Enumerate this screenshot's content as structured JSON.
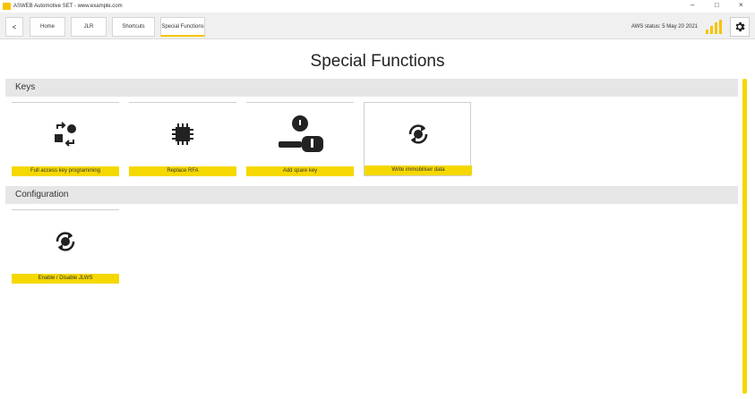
{
  "window": {
    "title": "ASWEB Automotive SET - www.example.com",
    "controls": {
      "minimize": "–",
      "maximize": "□",
      "close": "×"
    }
  },
  "toolbar": {
    "back_arrow": "<",
    "back_small": "",
    "tabs": [
      {
        "label": "Home"
      },
      {
        "label": "JLR"
      },
      {
        "label": "Shortcuts"
      },
      {
        "label": "Special Functions"
      }
    ],
    "status_text": "AWS status: 5 May 20 2021",
    "signal_icon": "signal-bars-icon",
    "settings_icon": "gear-icon"
  },
  "page": {
    "title": "Special Functions"
  },
  "sections": [
    {
      "title": "Keys",
      "tiles": [
        {
          "label": "Full access key programming",
          "icon": "key-swap-icon"
        },
        {
          "label": "Replace RFA",
          "icon": "chip-icon"
        },
        {
          "label": "Add spare key",
          "icon": "key-person-icon"
        },
        {
          "label": "Write immobiliser data",
          "icon": "refresh-chip-icon"
        }
      ]
    },
    {
      "title": "Configuration",
      "tiles": [
        {
          "label": "Enable / Disable JLWS",
          "icon": "refresh-chip-icon"
        }
      ]
    }
  ],
  "colors": {
    "accent": "#f5d800",
    "section_bg": "#e6e6e6",
    "toolbar_bg": "#f0f0f0"
  }
}
